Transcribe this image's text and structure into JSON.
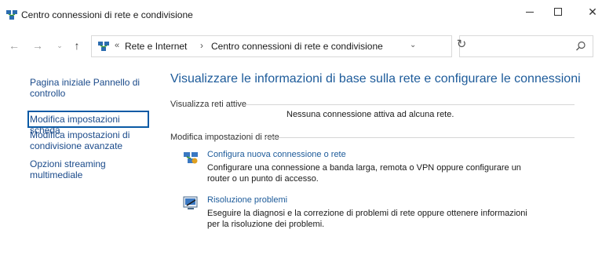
{
  "window": {
    "title": "Centro connessioni di rete e condivisione",
    "minimize_icon": "minimize-icon",
    "maximize_icon": "maximize-icon",
    "close_icon": "close-icon"
  },
  "nav": {
    "back_icon": "arrow-left-icon",
    "forward_icon": "arrow-right-icon",
    "recent_icon": "chevron-down-icon",
    "up_icon": "arrow-up-icon",
    "breadcrumb_sep0": "«",
    "breadcrumbs": [
      "Rete e Internet",
      "Centro connessioni di rete e condivisione"
    ],
    "breadcrumb_sep": "›",
    "refresh_icon": "refresh-icon",
    "search_placeholder": ""
  },
  "sidebar": {
    "items": [
      {
        "label": "Pagina iniziale Pannello di controllo"
      },
      {
        "label": "Modifica impostazioni scheda"
      },
      {
        "label": "Modifica impostazioni di condivisione avanzate"
      },
      {
        "label": "Opzioni streaming multimediale"
      }
    ]
  },
  "main": {
    "heading": "Visualizzare le informazioni di base sulla rete e configurare le connessioni",
    "active_networks_label": "Visualizza reti attive",
    "no_connection_text": "Nessuna connessione attiva ad alcuna rete.",
    "change_settings_label": "Modifica impostazioni di rete",
    "tasks": [
      {
        "link": "Configura nuova connessione o rete",
        "description": "Configurare una connessione a banda larga, remota o VPN oppure configurare un router o un punto di accesso.",
        "icon": "network-setup-icon"
      },
      {
        "link": "Risoluzione problemi",
        "description": "Eseguire la diagnosi e la correzione di problemi di rete oppure ottenere informazioni per la risoluzione dei problemi.",
        "icon": "troubleshoot-icon"
      }
    ]
  },
  "colors": {
    "link": "#1d5b9a",
    "focus": "#0a5aa5"
  }
}
